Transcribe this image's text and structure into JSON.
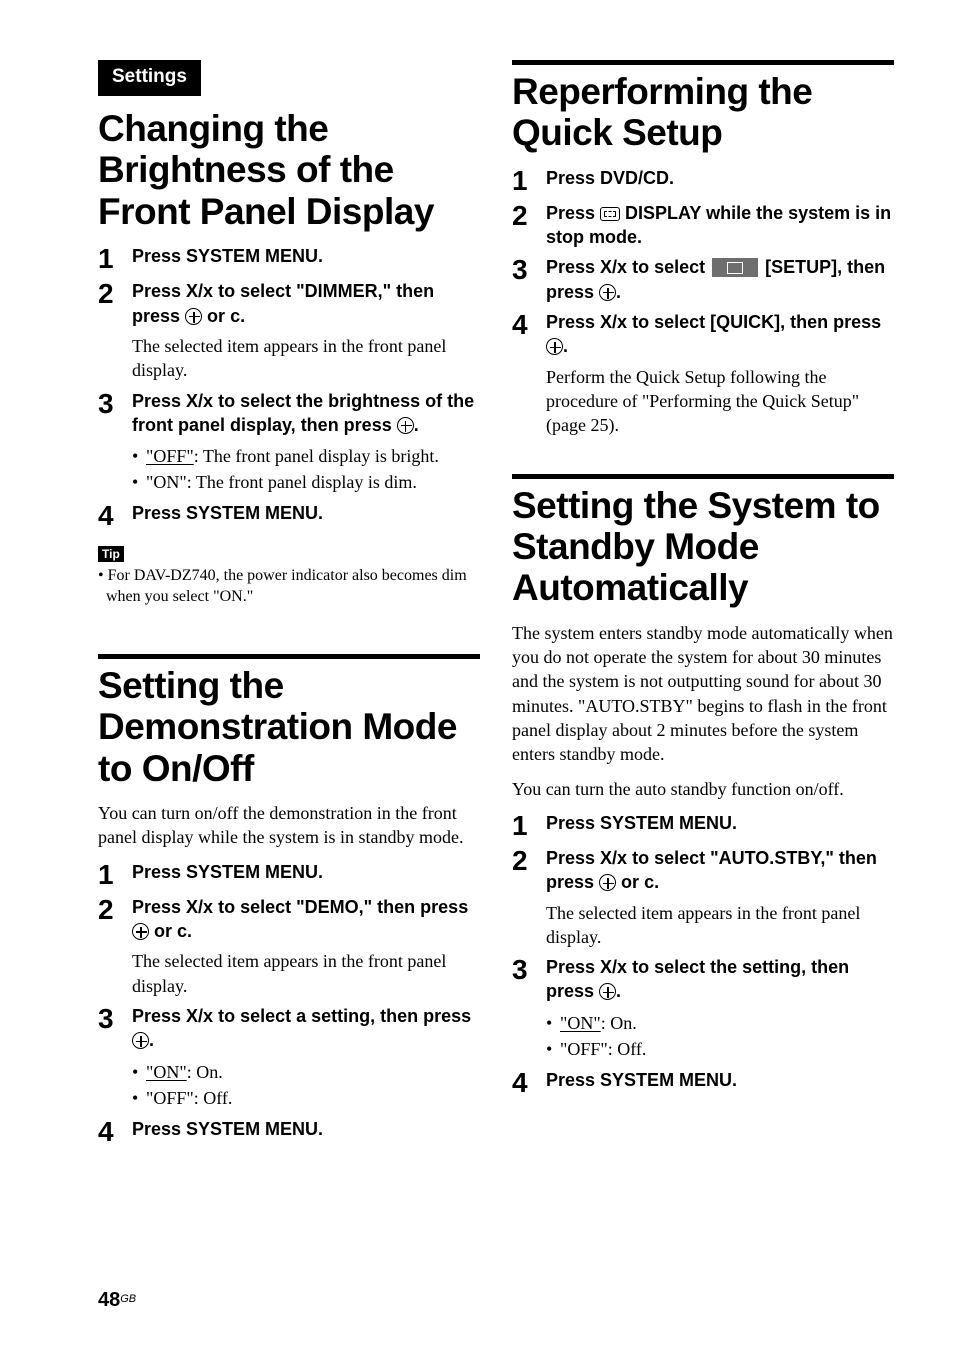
{
  "page_number": "48",
  "page_lang": "GB",
  "settings_tab": "Settings",
  "tip_label": "Tip",
  "glyphs": {
    "updown": "X/x",
    "right": "c"
  },
  "left": {
    "s1": {
      "title": "Changing the Brightness of the Front Panel Display",
      "step1": "Press SYSTEM MENU.",
      "step2a": "Press ",
      "step2b": " to select \"DIMMER,\" then press ",
      "step2c": " or ",
      "step2d": ".",
      "step2_plain": "The selected item appears in the front panel display.",
      "step3a": "Press ",
      "step3b": " to select the brightness of the front panel display, then press ",
      "step3c": ".",
      "bullet1_u": "\"OFF\"",
      "bullet1_r": ": The front panel display is bright.",
      "bullet2": "\"ON\": The front panel display is dim.",
      "step4": "Press SYSTEM MENU.",
      "tip": "• For DAV-DZ740, the power indicator also becomes dim when you select \"ON.\""
    },
    "s2": {
      "title": "Setting the Demonstration Mode to On/Off",
      "intro": "You can turn on/off the demonstration in the front panel display while the system is in standby mode.",
      "step1": "Press SYSTEM MENU.",
      "step2a": "Press ",
      "step2b": " to select \"DEMO,\" then press ",
      "step2c": " or ",
      "step2d": ".",
      "step2_plain": "The selected item appears in the front panel display.",
      "step3a": "Press ",
      "step3b": " to select a setting, then press ",
      "step3c": ".",
      "bullet1_u": "\"ON\"",
      "bullet1_r": ": On.",
      "bullet2": "\"OFF\": Off.",
      "step4": "Press SYSTEM MENU."
    }
  },
  "right": {
    "s1": {
      "title": "Reperforming the Quick Setup",
      "step1": "Press DVD/CD.",
      "step2a": "Press ",
      "step2b": " DISPLAY while the system is in stop mode.",
      "step3a": "Press ",
      "step3b": " to select ",
      "step3c": " [SETUP], then press ",
      "step3d": ".",
      "step4a": "Press ",
      "step4b": " to select [QUICK], then press ",
      "step4c": ".",
      "step4_plain": "Perform the Quick Setup following the procedure of \"Performing the Quick Setup\" (page 25)."
    },
    "s2": {
      "title": "Setting the System to Standby Mode Automatically",
      "intro1": "The system enters standby mode automatically when you do not operate the system for about 30 minutes and the system is not outputting sound for about 30 minutes. \"AUTO.STBY\" begins to flash in the front panel display about 2 minutes before the system enters standby mode.",
      "intro2": "You can turn the auto standby function on/off.",
      "step1": "Press SYSTEM MENU.",
      "step2a": "Press ",
      "step2b": " to select \"AUTO.STBY,\" then press ",
      "step2c": " or ",
      "step2d": ".",
      "step2_plain": "The selected item appears in the front panel display.",
      "step3a": "Press ",
      "step3b": " to select the setting, then press ",
      "step3c": ".",
      "bullet1_u": "\"ON\"",
      "bullet1_r": ": On.",
      "bullet2": "\"OFF\": Off.",
      "step4": "Press SYSTEM MENU."
    }
  }
}
